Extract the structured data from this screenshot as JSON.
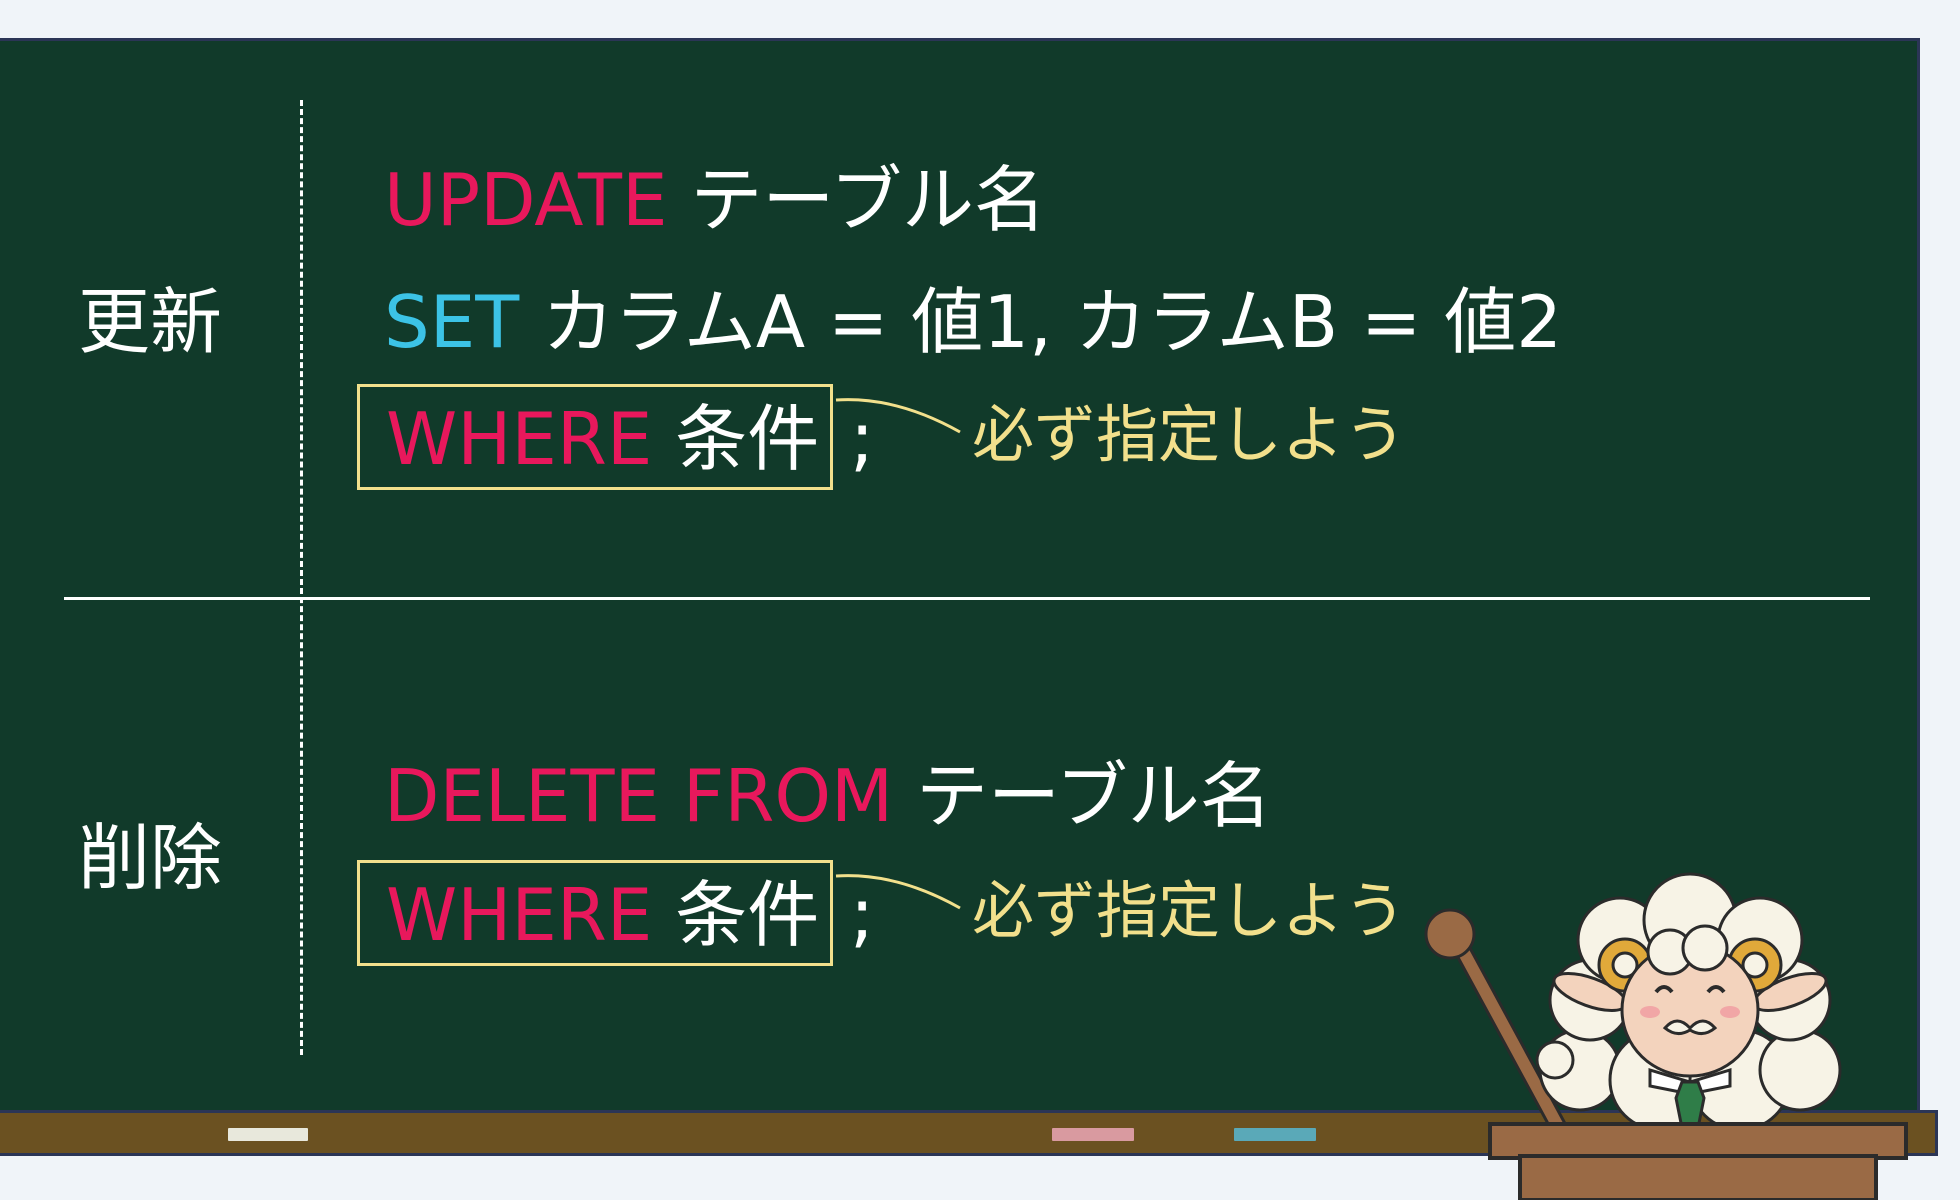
{
  "sections": {
    "update": {
      "label": "更新",
      "line1_kw": "UPDATE",
      "line1_rest": " テーブル名",
      "line2_kw": "SET",
      "line2_rest": " カラムA = 値1, カラムB = 値2",
      "where_kw": "WHERE",
      "where_rest": " 条件",
      "semicolon": ";",
      "note": "必ず指定しよう"
    },
    "delete": {
      "label": "削除",
      "line1_kw": "DELETE FROM",
      "line1_rest": " テーブル名",
      "where_kw": "WHERE",
      "where_rest": " 条件",
      "semicolon": ";",
      "note": "必ず指定しよう"
    }
  },
  "colors": {
    "board": "#113a2a",
    "keyword_red": "#e8185c",
    "keyword_blue": "#3cc3e6",
    "highlight_yellow": "#f2e08c",
    "tray": "#6b5121"
  },
  "chalks": [
    {
      "color": "#e8e8dc"
    },
    {
      "color": "#d99aa0"
    },
    {
      "color": "#5aa9b8"
    }
  ],
  "icons": [
    "sheep-teacher-icon",
    "pointer-stick-icon",
    "podium-icon"
  ]
}
